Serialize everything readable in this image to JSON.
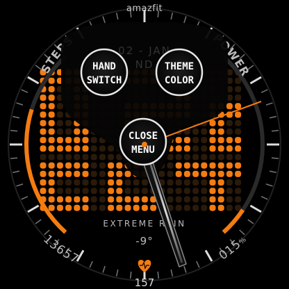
{
  "brand": "amazfit",
  "colors": {
    "accent": "#f57c10",
    "accent_dark": "#3a2410",
    "ring_gray": "#8a8a8a",
    "menu_bg": "#050505",
    "button_fill": "#111111",
    "button_text": "#ffffff",
    "label_text": "#bdbdbd"
  },
  "gauges": {
    "steps": {
      "label": "STEPS",
      "value": "13657",
      "progress": 0.68
    },
    "power": {
      "label": "POWER",
      "value": "015",
      "unit": "%",
      "progress": 0.15
    }
  },
  "date_partial": "02 - JAN",
  "date_partial2": "ND",
  "weather": {
    "condition": "EXTREME RAIN",
    "temperature": "-9°"
  },
  "heart_rate": {
    "value": "157",
    "icon": "heart-icon"
  },
  "menu": {
    "buttons": [
      {
        "id": "hand-switch",
        "line1": "HAND",
        "line2": "SWITCH"
      },
      {
        "id": "theme-color",
        "line1": "THEME",
        "line2": "COLOR"
      },
      {
        "id": "close-menu",
        "line1": "CLOSE",
        "line2": "MENU"
      }
    ]
  }
}
